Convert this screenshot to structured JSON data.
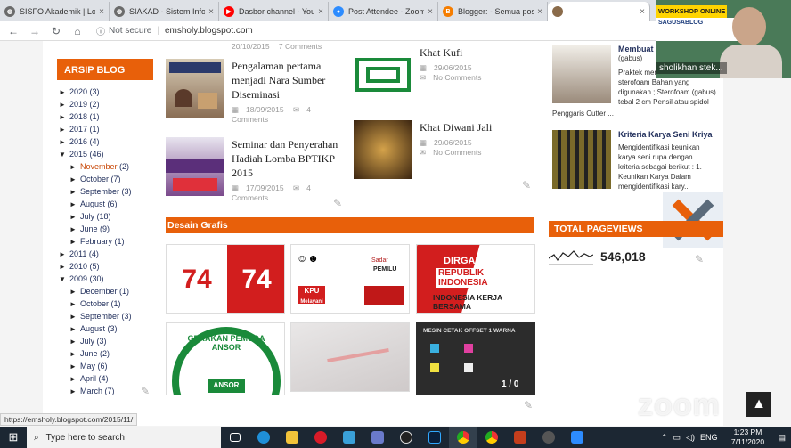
{
  "browser": {
    "tabs": [
      {
        "title": "SISFO Akademik | Log...",
        "color": "#6b6b6b",
        "glyph": "◍"
      },
      {
        "title": "SIAKAD - Sistem Inform...",
        "color": "#6b6b6b",
        "glyph": "◍"
      },
      {
        "title": "Dasbor channel - YouT...",
        "color": "#ff0000",
        "glyph": "▶"
      },
      {
        "title": "Post Attendee - Zoom",
        "color": "#2d8cff",
        "glyph": "●"
      },
      {
        "title": "Blogger: - Semua pos...",
        "color": "#f57d00",
        "glyph": "B"
      },
      {
        "title": "",
        "color": "#8a6b4a",
        "glyph": ""
      }
    ],
    "url": "emsholy.blogspot.com",
    "not_secure": "Not secure"
  },
  "archive": {
    "title": "ARSIP BLOG",
    "rows": [
      {
        "level": 1,
        "tri": "►",
        "label": "2020",
        "count": "(3)"
      },
      {
        "level": 1,
        "tri": "►",
        "label": "2019",
        "count": "(2)"
      },
      {
        "level": 1,
        "tri": "►",
        "label": "2018",
        "count": "(1)"
      },
      {
        "level": 1,
        "tri": "►",
        "label": "2017",
        "count": "(1)"
      },
      {
        "level": 1,
        "tri": "►",
        "label": "2016",
        "count": "(4)"
      },
      {
        "level": 1,
        "tri": "▼",
        "label": "2015",
        "count": "(46)"
      },
      {
        "level": 2,
        "tri": "►",
        "label": "November",
        "count": "(2)",
        "sel": true
      },
      {
        "level": 2,
        "tri": "►",
        "label": "October",
        "count": "(7)"
      },
      {
        "level": 2,
        "tri": "►",
        "label": "September",
        "count": "(3)"
      },
      {
        "level": 2,
        "tri": "►",
        "label": "August",
        "count": "(6)"
      },
      {
        "level": 2,
        "tri": "►",
        "label": "July",
        "count": "(18)"
      },
      {
        "level": 2,
        "tri": "►",
        "label": "June",
        "count": "(9)"
      },
      {
        "level": 2,
        "tri": "►",
        "label": "February",
        "count": "(1)"
      },
      {
        "level": 1,
        "tri": "►",
        "label": "2011",
        "count": "(4)"
      },
      {
        "level": 1,
        "tri": "►",
        "label": "2010",
        "count": "(5)"
      },
      {
        "level": 1,
        "tri": "▼",
        "label": "2009",
        "count": "(30)"
      },
      {
        "level": 2,
        "tri": "►",
        "label": "December",
        "count": "(1)"
      },
      {
        "level": 2,
        "tri": "►",
        "label": "October",
        "count": "(1)"
      },
      {
        "level": 2,
        "tri": "►",
        "label": "September",
        "count": "(3)"
      },
      {
        "level": 2,
        "tri": "►",
        "label": "August",
        "count": "(3)"
      },
      {
        "level": 2,
        "tri": "►",
        "label": "July",
        "count": "(3)"
      },
      {
        "level": 2,
        "tri": "►",
        "label": "June",
        "count": "(2)"
      },
      {
        "level": 2,
        "tri": "►",
        "label": "May",
        "count": "(6)"
      },
      {
        "level": 2,
        "tri": "►",
        "label": "April",
        "count": "(4)"
      },
      {
        "level": 2,
        "tri": "►",
        "label": "March",
        "count": "(7)"
      }
    ]
  },
  "posts": {
    "top_left_meta": {
      "date": "20/10/2015",
      "comments": "7 Comments"
    },
    "p1": {
      "title": "Pengalaman pertama menjadi Nara Sumber Diseminasi",
      "date": "18/09/2015",
      "comments": "4 Comments"
    },
    "p2": {
      "title": "Seminar dan Penyerahan Hadiah Lomba BPTIKP 2015",
      "date": "17/09/2015",
      "comments": "4 Comments"
    },
    "p3": {
      "title": "Khat Kufi",
      "date": "29/06/2015",
      "comments": "No Comments"
    },
    "p4": {
      "title": "Khat Diwani Jali",
      "date": "29/06/2015",
      "comments": "No Comments"
    }
  },
  "sections": {
    "desain": "Desain Grafis",
    "pageviews": "TOTAL PAGEVIEWS",
    "pageviews_value": "546,018"
  },
  "grid": {
    "dirgahayu_line1": "DIRGAHAYU",
    "dirgahayu_line2": "REPUBLIK INDONESIA",
    "dirgahayu_line3": "INDONESIA KERJA BERSAMA",
    "ansor": "GERAKAN PEMUDA ANSOR",
    "ansor_small": "ANSOR",
    "mesin": "MESIN CETAK OFFSET 1 WARNA",
    "mesin_ratio": "1 / 0",
    "kpu": "KPU",
    "kpu_sub": "Melayani",
    "sadar": "Sadar",
    "pemilu": "PEMILU"
  },
  "right": {
    "r1_title": "Membuat",
    "r1_title2": "(gabus)",
    "r1_text": "Praktek mem... bahan sterofoam Bahan yang digunakan ; Sterofoam (gabus) tebal 2 cm Pensil atau spidol Penggaris Cutter ...",
    "r1_penggaris": "Penggaris Cutter ...",
    "r2_title": "Kriteria Karya Seni Kriya",
    "r2_text": "Mengidentifikasi keunikan karya seni rupa dengan kriteria sebagai berikut : 1. Keunikan Karya Dalam mengidentifikasi kary..."
  },
  "status_url": "https://emsholy.blogspot.com/2015/11/",
  "zoom": {
    "name": "sholikhan stek...",
    "banner": "WORKSHOP ONLINE",
    "banner_sub": "SAGUSABLOG",
    "watermark": "zoom"
  },
  "taskbar": {
    "search_placeholder": "Type here to search",
    "lang": "ENG",
    "time": "1:23 PM",
    "date": "7/11/2020"
  },
  "colors": {
    "accent": "#e8600a",
    "taskbar": "#1c2733"
  }
}
